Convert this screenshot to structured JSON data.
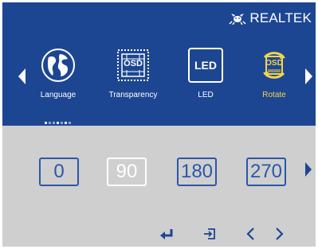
{
  "brand": {
    "name": "REALTEK",
    "logo_icon": "crab-icon"
  },
  "menu": {
    "items": [
      {
        "label": "Language",
        "icon": "globe-icon",
        "active": false
      },
      {
        "label": "Transparency",
        "icon": "osd-transparency-icon",
        "active": false
      },
      {
        "label": "LED",
        "icon": "led-icon",
        "icon_text": "LED",
        "active": false
      },
      {
        "label": "Rotate",
        "icon": "rotate-icon",
        "active": true
      }
    ]
  },
  "osd_icon_text": "OSD",
  "options": {
    "values": [
      "0",
      "90",
      "180",
      "270"
    ],
    "selected": "90"
  },
  "colors": {
    "panel_blue": "#1d4692",
    "panel_grey": "#cfcfcf",
    "accent_yellow": "#f2d54a",
    "option_blue": "#2b57a8"
  },
  "keys": [
    "enter-icon",
    "exit-icon",
    "chevron-left-icon",
    "chevron-right-icon"
  ]
}
